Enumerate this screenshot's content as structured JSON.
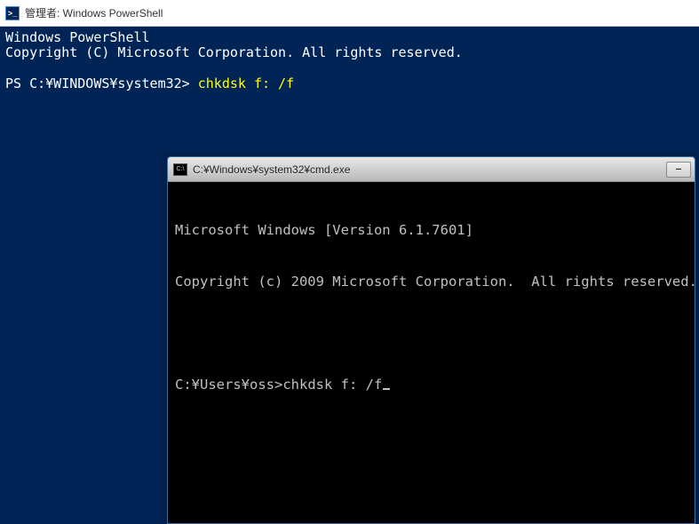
{
  "powershell": {
    "title": "管理者: Windows PowerShell",
    "header_line1": "Windows PowerShell",
    "header_line2": "Copyright (C) Microsoft Corporation. All rights reserved.",
    "prompt": "PS C:¥WINDOWS¥system32> ",
    "command": "chkdsk f: /f"
  },
  "cmd": {
    "title": "C:¥Windows¥system32¥cmd.exe",
    "header_line1": "Microsoft Windows [Version 6.1.7601]",
    "header_line2": "Copyright (c) 2009 Microsoft Corporation.  All rights reserved.",
    "prompt": "C:¥Users¥oss>",
    "command": "chkdsk f: /f",
    "minimize_glyph": "—"
  }
}
